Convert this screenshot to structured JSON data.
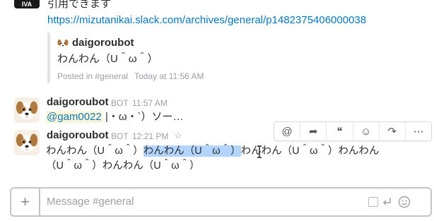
{
  "top_message": {
    "avatar_text": "IVA",
    "text": "引用できます",
    "link": "https://mizutanikai.slack.com/archives/general/p1482375406000038"
  },
  "quote": {
    "author": "daigoroubot",
    "text": "わんわん（U＾ω＾）",
    "posted_in": "Posted in #general",
    "time": "Today at 11:56 AM"
  },
  "messages": [
    {
      "author": "daigoroubot",
      "badge": "BOT",
      "time": "11:57 AM",
      "mention": "@gam0022",
      "text": "|・ω・`）ソー…"
    },
    {
      "author": "daigoroubot",
      "badge": "BOT",
      "time": "12:21 PM",
      "star": "☆",
      "line1_before": "わんわん（U＾ω＾）",
      "line1_selected": "わんわん（U＾ω＾）",
      "line1_after": "わんわん（U＾ω＾）わんわん",
      "line2": "（U＾ω＾）わんわん（U＾ω＾）"
    }
  ],
  "toolbar": {
    "icons": [
      "at-icon",
      "share-arrow-icon",
      "quote-icon",
      "add-reaction-icon",
      "forward-icon",
      "more-icon"
    ],
    "glyphs": [
      "@",
      "➦",
      "❝",
      "☺",
      "↷",
      "⋯"
    ]
  },
  "composer": {
    "plus": "+",
    "placeholder": "Message #general"
  },
  "colors": {
    "link": "#0576b9",
    "mention_bg": "#fff6d9",
    "selection": "#b3d4fc"
  }
}
